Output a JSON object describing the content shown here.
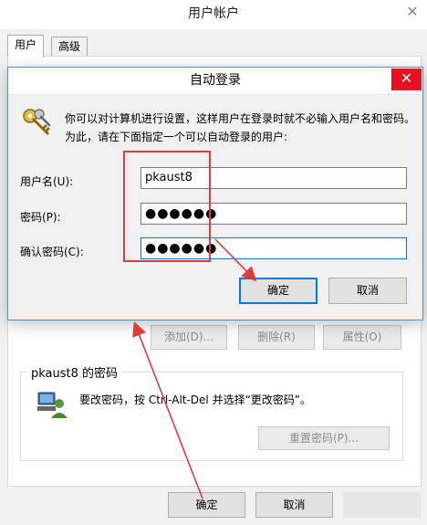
{
  "outer": {
    "title": "用户帐户",
    "close_glyph": "✕",
    "tabs": [
      {
        "label": "用户"
      },
      {
        "label": "高级"
      }
    ],
    "buttons": {
      "add": "添加(D)...",
      "delete": "删除(R)",
      "properties": "属性(O)"
    },
    "password_group": {
      "title": "pkaust8 的密码",
      "message": "要改密码，按 Ctrl-Alt-Del 并选择“更改密码”。",
      "reset_button": "重置密码(P)..."
    },
    "ok_button": "确定",
    "cancel_button": "取消"
  },
  "dialog": {
    "title": "自动登录",
    "close_glyph": "✕",
    "description": "你可以对计算机进行设置，这样用户在登录时就不必输入用户名和密码。为此，请在下面指定一个可以自动登录的用户:",
    "username_label": "用户名(U):",
    "username_value": "pkaust8",
    "password_label": "密码(P):",
    "password_value": "●●●●●●",
    "confirm_label": "确认密码(C):",
    "confirm_value": "●●●●●●",
    "ok_button": "确定",
    "cancel_button": "取消"
  },
  "colors": {
    "annotation_red": "#e03c3c",
    "accent_blue": "#0078d7",
    "close_red": "#e81123"
  }
}
